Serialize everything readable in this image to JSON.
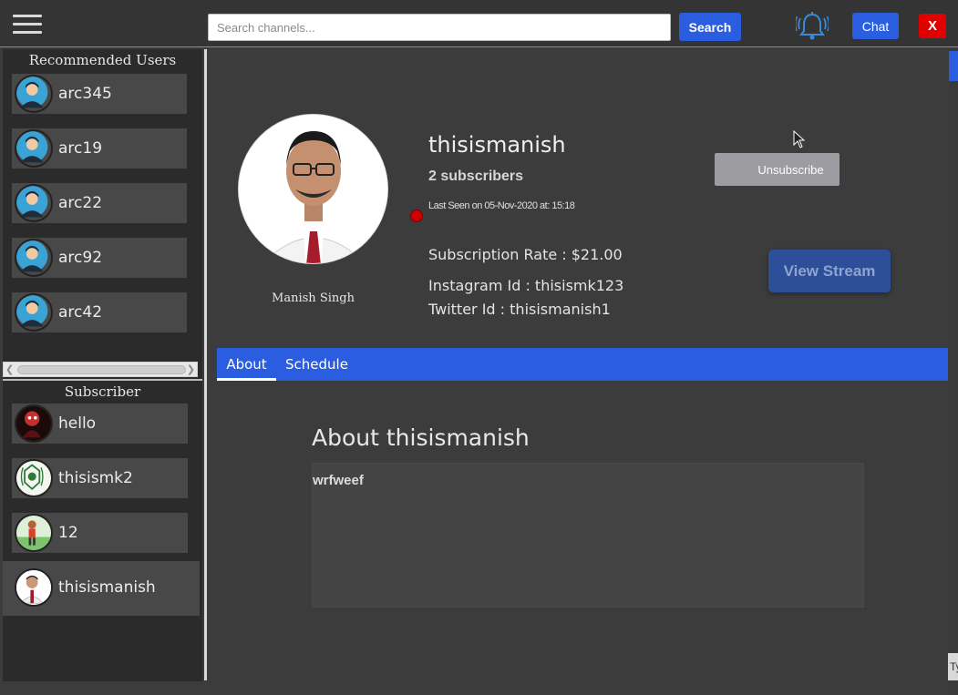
{
  "topbar": {
    "search_placeholder": "Search channels...",
    "search_label": "Search",
    "chat_label": "Chat",
    "close_label": "X"
  },
  "sidebar": {
    "recommended_title": "Recommended Users",
    "recommended": [
      {
        "name": "arc345"
      },
      {
        "name": "arc19"
      },
      {
        "name": "arc22"
      },
      {
        "name": "arc92"
      },
      {
        "name": "arc42"
      }
    ],
    "subscriber_title": "Subscriber",
    "subscribers": [
      {
        "name": "hello"
      },
      {
        "name": "thisismk2"
      },
      {
        "name": "12"
      },
      {
        "name": "thisismanish"
      }
    ]
  },
  "profile": {
    "username": "thisismanish",
    "subscribers": "2 subscribers",
    "last_seen": "Last Seen on 05-Nov-2020 at: 15:18",
    "subscription_rate": "Subscription Rate : $21.00",
    "instagram": "Instagram Id : thisismk123",
    "twitter": "Twitter Id : thisismanish1",
    "display_name": "Manish Singh",
    "unsubscribe_label": "Unsubscribe",
    "view_stream_label": "View Stream"
  },
  "tabs": [
    {
      "label": "About"
    },
    {
      "label": "Schedule"
    }
  ],
  "about": {
    "title": "About thisismanish",
    "text": "wrfweef"
  },
  "edge_tab": "Ty",
  "colors": {
    "accent": "#2a5de0",
    "close": "#e00000",
    "status_offline": "#d00000"
  }
}
